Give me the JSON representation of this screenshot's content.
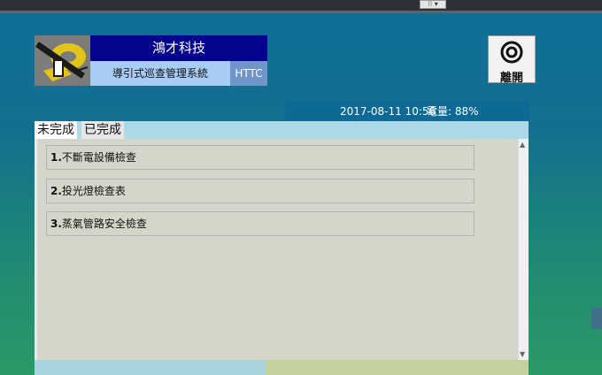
{
  "header": {
    "company_name": "鴻才科技",
    "system_name": "導引式巡查管理系統",
    "abbreviation": "HTTC",
    "exit_label": "離開"
  },
  "status": {
    "datetime": "2017-08-11 10:56",
    "battery_label": "電量: 88%"
  },
  "tabs": [
    {
      "label": "未完成",
      "active": true
    },
    {
      "label": "已完成",
      "active": false
    }
  ],
  "items": [
    {
      "num": "1.",
      "label": "不斷電設備檢查"
    },
    {
      "num": "2.",
      "label": "投光燈檢查表"
    },
    {
      "num": "3.",
      "label": "蒸氣管路安全檢查"
    }
  ],
  "colors": {
    "company_bg": "#04048e",
    "system_bg": "#a7cdf5",
    "abbr_bg": "#6f95c9",
    "status_bg": "#0c6a94",
    "panel_bg": "#d5d6c9"
  }
}
